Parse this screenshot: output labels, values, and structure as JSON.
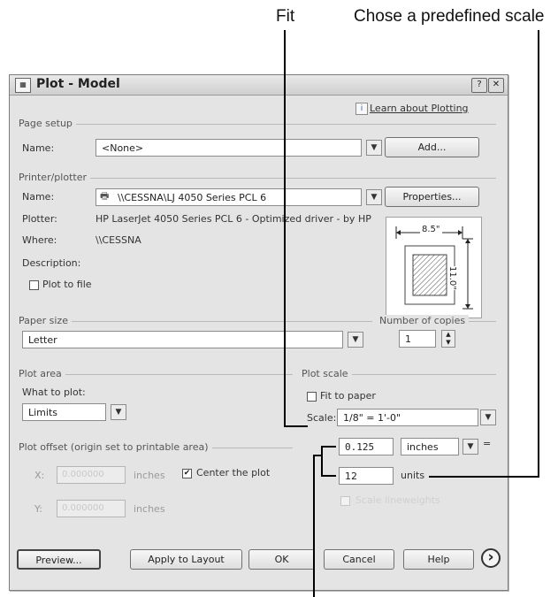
{
  "callouts": {
    "fit": "Fit",
    "predefined": "Chose a predefined scale"
  },
  "window": {
    "title": "Plot - Model",
    "help_btn": "?",
    "close_btn": "✕",
    "learn_link": "Learn about Plotting"
  },
  "page_setup": {
    "group": "Page setup",
    "name_label": "Name:",
    "name_value": "<None>",
    "add_button": "Add..."
  },
  "printer": {
    "group": "Printer/plotter",
    "name_label": "Name:",
    "name_value": "\\\\CESSNA\\LJ 4050 Series PCL 6",
    "properties_button": "Properties...",
    "plotter_label": "Plotter:",
    "plotter_value": "HP LaserJet 4050 Series PCL 6 - Optimized driver - by HP",
    "where_label": "Where:",
    "where_value": "\\\\CESSNA",
    "description_label": "Description:",
    "plot_to_file": "Plot to file",
    "paper_width": "8.5\"",
    "paper_height": "11.0\""
  },
  "paper_size": {
    "group": "Paper size",
    "value": "Letter"
  },
  "copies": {
    "group": "Number of copies",
    "value": "1"
  },
  "plot_area": {
    "group": "Plot area",
    "what_label": "What to plot:",
    "value": "Limits"
  },
  "plot_scale": {
    "group": "Plot scale",
    "fit_label": "Fit to paper",
    "scale_label": "Scale:",
    "scale_value": "1/8\" = 1'-0\"",
    "value1": "0.125",
    "unit1": "inches",
    "equals": "=",
    "value2": "12",
    "unit2": "units",
    "scale_lineweights": "Scale lineweights"
  },
  "plot_offset": {
    "group": "Plot offset (origin set to printable area)",
    "x_label": "X:",
    "x_value": "0.000000",
    "x_unit": "inches",
    "y_label": "Y:",
    "y_value": "0.000000",
    "y_unit": "inches",
    "center_label": "Center the plot"
  },
  "buttons": {
    "preview": "Preview...",
    "apply": "Apply to Layout",
    "ok": "OK",
    "cancel": "Cancel",
    "help": "Help",
    "expand": "›"
  }
}
